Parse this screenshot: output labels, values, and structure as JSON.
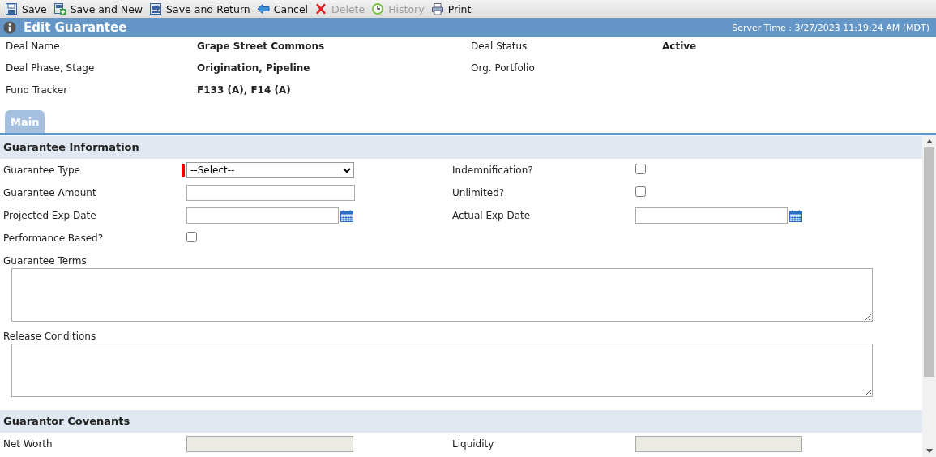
{
  "toolbar": [
    {
      "label": "Save",
      "kind": "save",
      "disabled": false
    },
    {
      "label": "Save and New",
      "kind": "new",
      "disabled": false
    },
    {
      "label": "Save and Return",
      "kind": "return",
      "disabled": false
    },
    {
      "label": "Cancel",
      "kind": "cancel",
      "disabled": false
    },
    {
      "label": "Delete",
      "kind": "delete",
      "disabled": true
    },
    {
      "label": "History",
      "kind": "history",
      "disabled": true
    },
    {
      "label": "Print",
      "kind": "print",
      "disabled": false
    }
  ],
  "header": {
    "title": "Edit Guarantee",
    "server_time": "Server Time : 3/27/2023 11:19:24 AM (MDT)"
  },
  "deal_info": [
    {
      "label": "Deal Name",
      "value": "Grape Street Commons"
    },
    {
      "label": "Deal Status",
      "value": "Active"
    },
    {
      "label": "Deal Phase, Stage",
      "value": "Origination, Pipeline"
    },
    {
      "label": "Org. Portfolio"
    },
    {
      "label": "Fund Tracker",
      "value": "F133 (A), F14 (A)"
    }
  ],
  "tabs": [
    {
      "label": "Main",
      "selected": true
    }
  ],
  "sections": [
    {
      "title": "Guarantee Information",
      "fields": [
        {
          "label": "Guarantee Type",
          "kind": "select",
          "value": "--Select--",
          "required": true
        },
        {
          "label": "Indemnification?",
          "kind": "checkbox",
          "checked": false
        },
        {
          "label": "Guarantee Amount",
          "kind": "text"
        },
        {
          "label": "Unlimited?",
          "kind": "checkbox",
          "checked": false
        },
        {
          "label": "Projected Exp Date",
          "kind": "date"
        },
        {
          "label": "Actual Exp Date",
          "kind": "date"
        },
        {
          "label": "Performance Based?",
          "kind": "checkbox",
          "checked": false
        },
        {
          "label": "Guarantee Terms",
          "kind": "textarea"
        },
        {
          "label": "Release Conditions",
          "kind": "textarea"
        }
      ]
    },
    {
      "title": "Guarantor Covenants",
      "fields": [
        {
          "label": "Net Worth",
          "kind": "readonly"
        },
        {
          "label": "Liquidity",
          "kind": "readonly"
        }
      ]
    }
  ]
}
